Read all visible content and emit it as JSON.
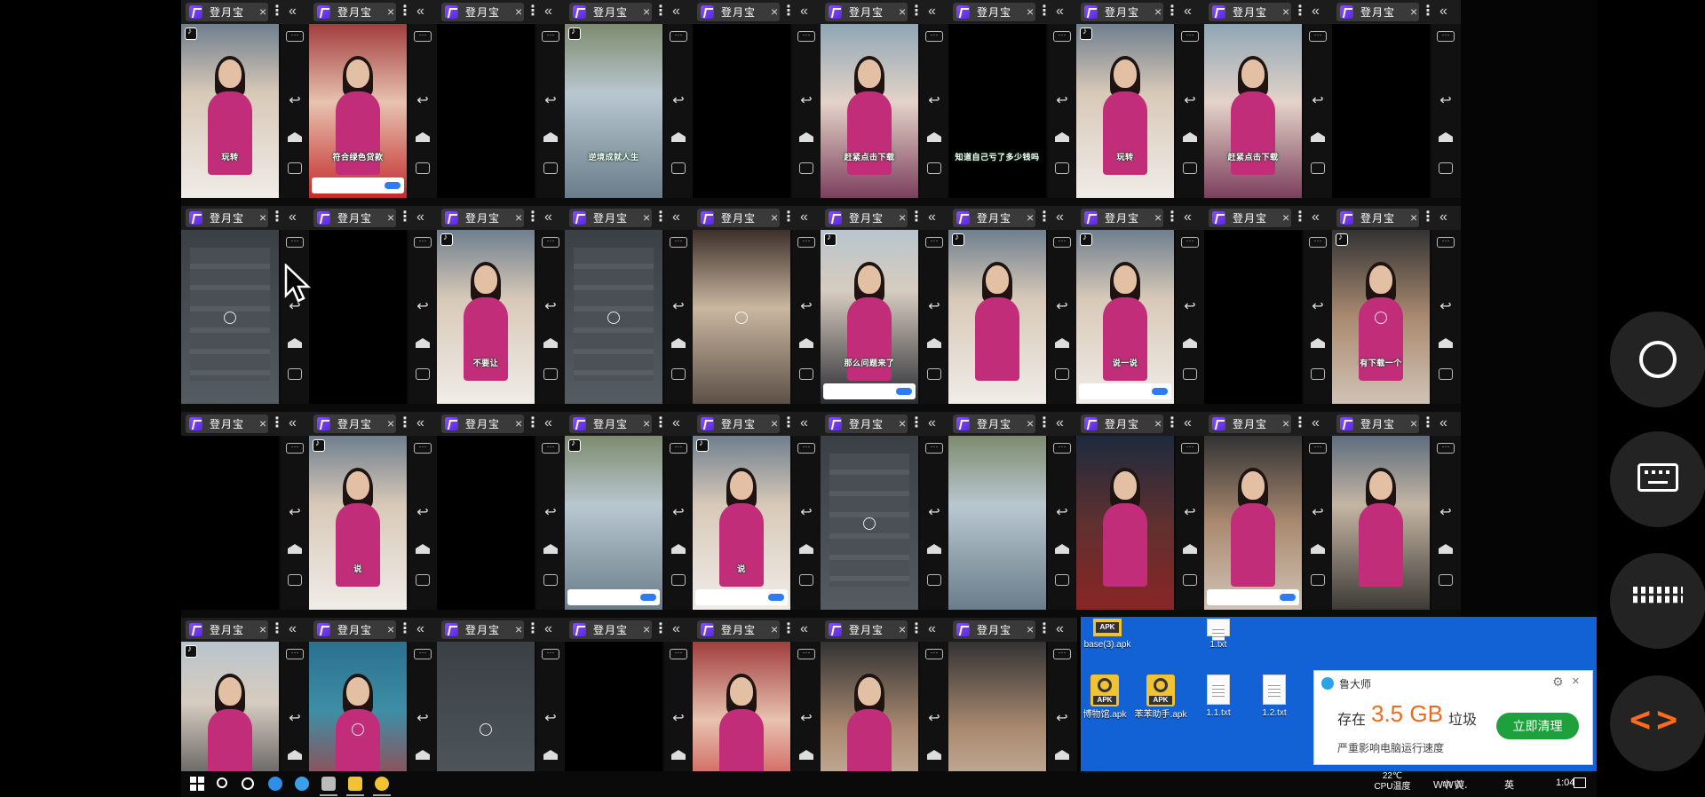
{
  "tab_label": "登月宝",
  "close_glyph": "×",
  "menu_glyph": "⋮",
  "collapse_glyph": "«",
  "more_glyph": "···",
  "back_glyph": "↩",
  "windows": [
    {
      "screen": "person",
      "bg": "gradient-e",
      "caption": "玩转",
      "tiktok": true
    },
    {
      "screen": "person",
      "bg": "gradient-c",
      "caption": "符合绿色贷款",
      "tiktok": false,
      "ad": true
    },
    {
      "screen": "black",
      "bg": "black",
      "caption": ""
    },
    {
      "screen": "scene",
      "bg": "gradient-f",
      "caption": "逆境成就人生",
      "tiktok": true
    },
    {
      "screen": "black",
      "bg": "black",
      "caption": ""
    },
    {
      "screen": "person",
      "bg": "gradient-d",
      "caption": "赶紧点击下载",
      "tiktok": false
    },
    {
      "screen": "scene",
      "bg": "black",
      "caption": "知道自己亏了多少钱吗",
      "tiktok": false
    },
    {
      "screen": "person",
      "bg": "gradient-e",
      "caption": "玩转",
      "tiktok": true
    },
    {
      "screen": "person",
      "bg": "gradient-d",
      "caption": "赶紧点击下载",
      "tiktok": false
    },
    {
      "screen": "black",
      "bg": "black",
      "caption": ""
    },
    {
      "screen": "app",
      "bg": "grey",
      "caption": "",
      "tap": true
    },
    {
      "screen": "black",
      "bg": "black",
      "caption": ""
    },
    {
      "screen": "person",
      "bg": "gradient-e",
      "caption": "不要让",
      "tiktok": true
    },
    {
      "screen": "app",
      "bg": "grey",
      "caption": "",
      "tap": true
    },
    {
      "screen": "scene",
      "bg": "gradient-i",
      "caption": "",
      "tap": true
    },
    {
      "screen": "person",
      "bg": "gradient-b",
      "caption": "那么问题来了",
      "tiktok": true,
      "ad": true
    },
    {
      "screen": "person",
      "bg": "gradient-e",
      "caption": "",
      "tiktok": true
    },
    {
      "screen": "person",
      "bg": "gradient-e",
      "caption": "说一说",
      "tiktok": true,
      "ad": true
    },
    {
      "screen": "black",
      "bg": "black",
      "caption": ""
    },
    {
      "screen": "person",
      "bg": "gradient-j",
      "caption": "有下载一个",
      "tiktok": true,
      "tap": true
    },
    {
      "screen": "black",
      "bg": "black",
      "caption": ""
    },
    {
      "screen": "person",
      "bg": "gradient-e",
      "caption": "说",
      "tiktok": true
    },
    {
      "screen": "black",
      "bg": "black",
      "caption": ""
    },
    {
      "screen": "scene",
      "bg": "gradient-f",
      "caption": "",
      "tiktok": true,
      "ad": true
    },
    {
      "screen": "person",
      "bg": "gradient-e",
      "caption": "说",
      "tiktok": true,
      "ad": true
    },
    {
      "screen": "app",
      "bg": "grey",
      "caption": "",
      "tap": true
    },
    {
      "screen": "scene",
      "bg": "gradient-f",
      "caption": "",
      "tiktok": false
    },
    {
      "screen": "person",
      "bg": "gradient-g",
      "caption": "",
      "tiktok": false
    },
    {
      "screen": "person",
      "bg": "gradient-j",
      "caption": "",
      "tiktok": false,
      "ad": true
    },
    {
      "screen": "person",
      "bg": "gradient-a",
      "caption": "",
      "tiktok": false
    },
    {
      "screen": "person",
      "bg": "gradient-b",
      "caption": "",
      "tiktok": true
    },
    {
      "screen": "person",
      "bg": "gradient-h",
      "caption": "",
      "tiktok": false,
      "tap": true
    },
    {
      "screen": "grey",
      "bg": "grey",
      "caption": "",
      "tap": true
    },
    {
      "screen": "black",
      "bg": "black",
      "caption": ""
    },
    {
      "screen": "person",
      "bg": "gradient-c",
      "caption": "",
      "tiktok": false
    },
    {
      "screen": "person",
      "bg": "gradient-j",
      "caption": "",
      "tiktok": false
    },
    {
      "screen": "scene",
      "bg": "gradient-j",
      "caption": "",
      "tiktok": false
    },
    {
      "screen": "scene",
      "bg": "gradient-i",
      "caption": "",
      "tiktok": false,
      "tap": true
    },
    {
      "screen": "person",
      "bg": "gradient-b",
      "caption": "",
      "tiktok": false
    },
    {
      "screen": "person",
      "bg": "gradient-f",
      "caption": "",
      "tiktok": false
    }
  ],
  "desktop_files": [
    {
      "name": "base(3).apk",
      "type": "apk-plain"
    },
    {
      "name": "1.txt",
      "type": "txt"
    },
    {
      "name": "博物馆.apk",
      "type": "apk"
    },
    {
      "name": "苯苯助手.apk",
      "type": "apk"
    },
    {
      "name": "1.1.txt",
      "type": "txt"
    },
    {
      "name": "1.2.txt",
      "type": "txt"
    }
  ],
  "popup": {
    "title": "鲁大师",
    "gear": "⚙",
    "close": "×",
    "prefix": "存在",
    "value": "3.5 GB",
    "suffix": "垃圾",
    "desc": "严重影响电脑运行速度",
    "button": "立即清理"
  },
  "taskbar": {
    "temp_value": "22℃",
    "temp_label": "CPU温度",
    "lang": "中 英",
    "ime": "英",
    "clock": "1:04"
  },
  "watermark": "www."
}
